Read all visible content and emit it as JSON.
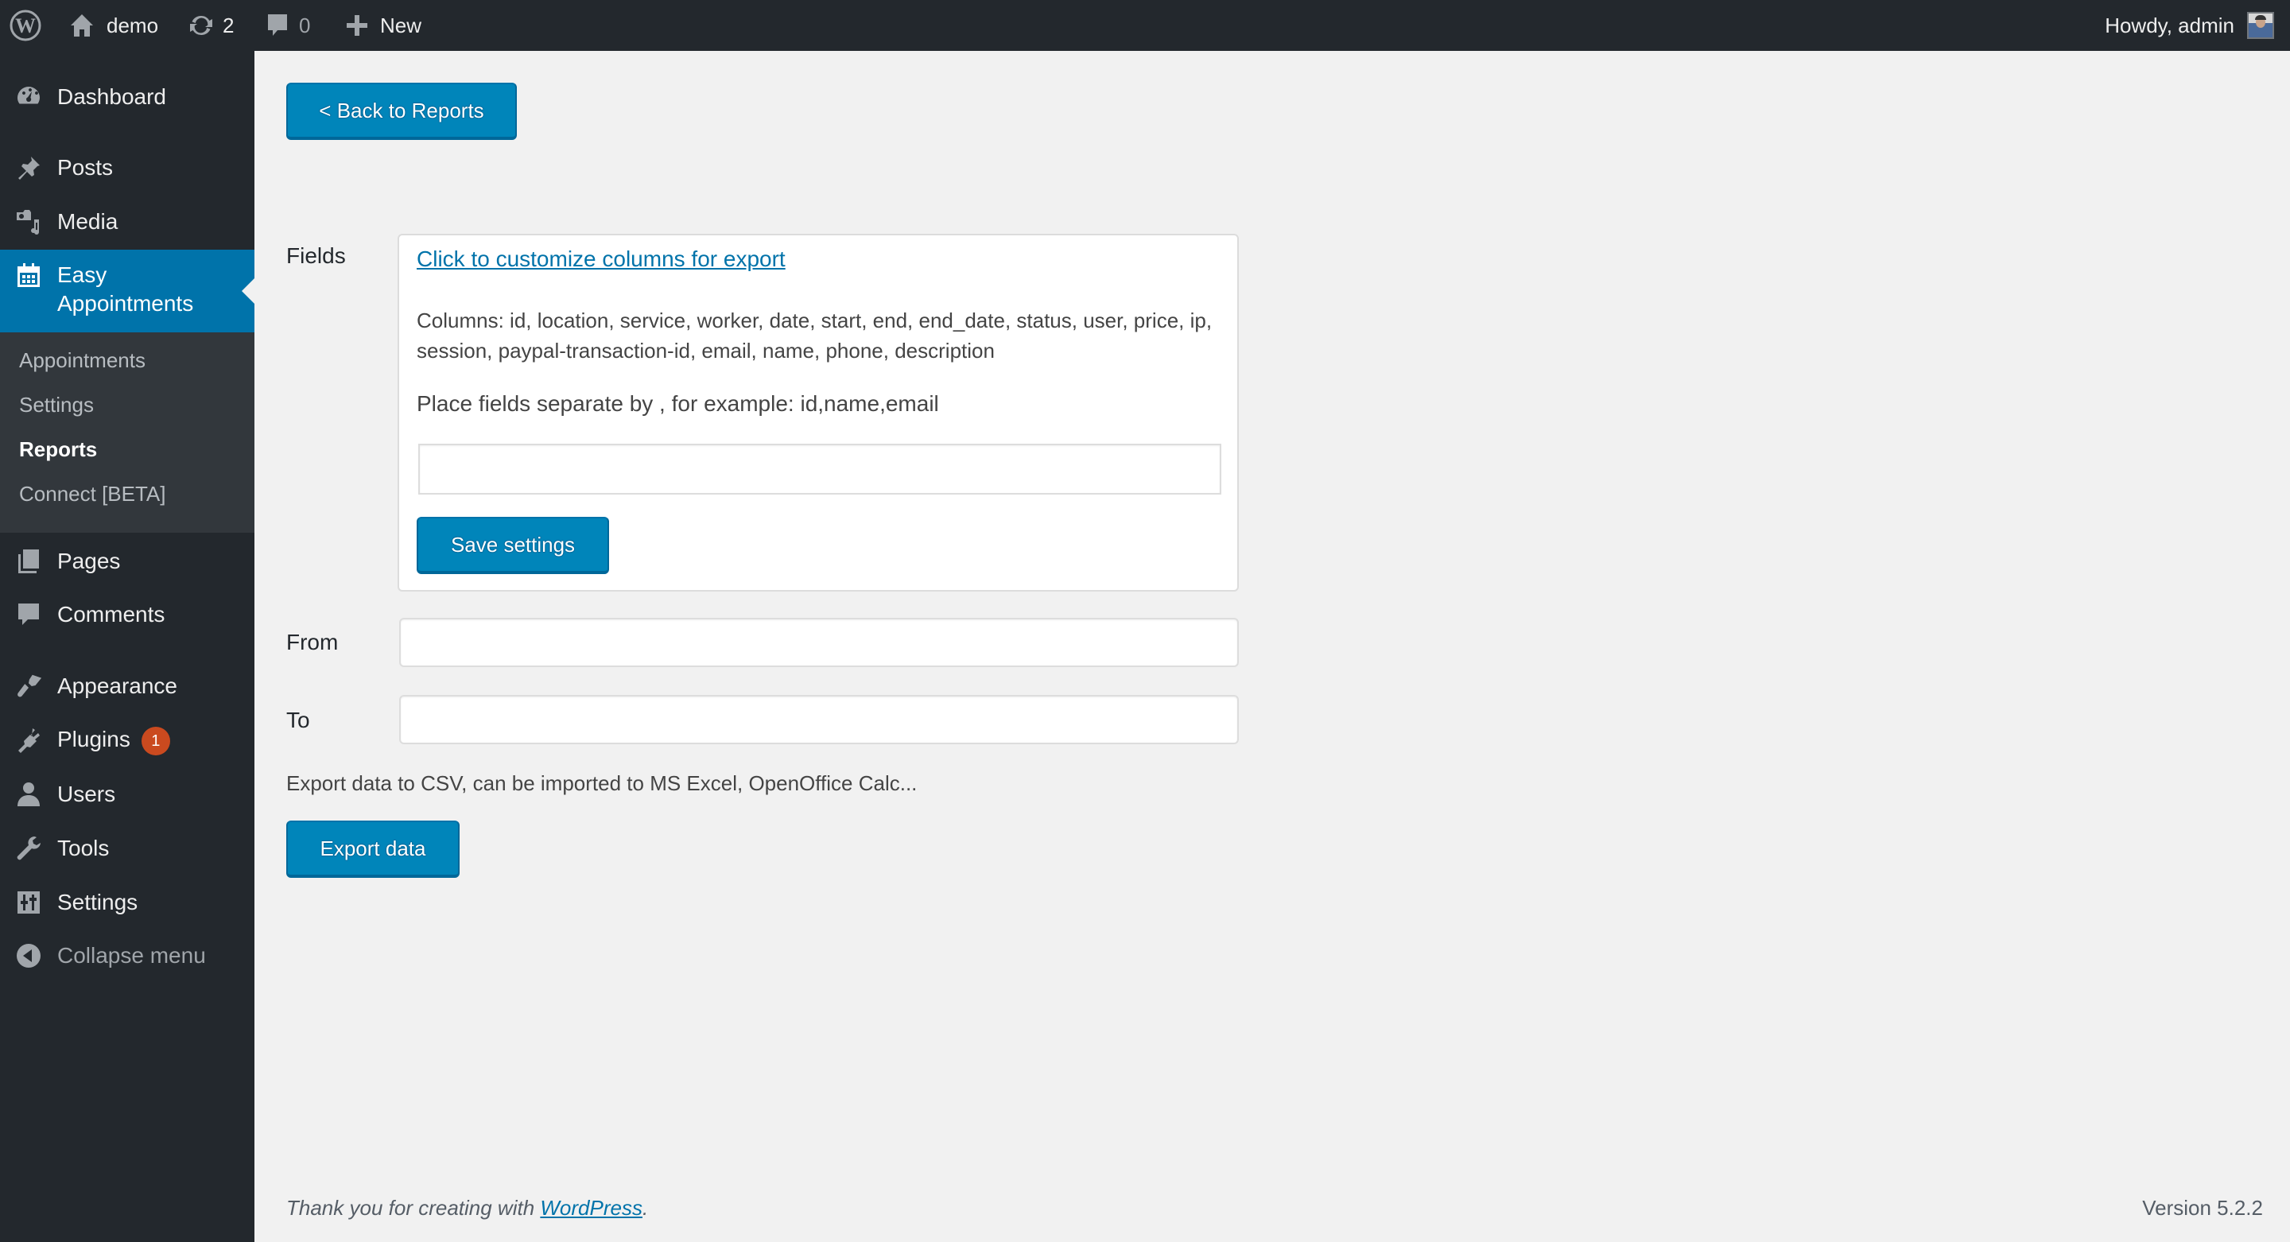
{
  "adminbar": {
    "site_name": "demo",
    "updates_count": "2",
    "comments_count": "0",
    "new_label": "New",
    "howdy": "Howdy, admin"
  },
  "sidebar": {
    "items": [
      {
        "label": "Dashboard",
        "icon": "dashboard-icon"
      },
      {
        "label": "Posts",
        "icon": "pin-icon"
      },
      {
        "label": "Media",
        "icon": "media-icon"
      },
      {
        "label": "Easy Appointments",
        "icon": "calendar-icon",
        "active": true
      },
      {
        "label": "Pages",
        "icon": "pages-icon"
      },
      {
        "label": "Comments",
        "icon": "comment-icon"
      },
      {
        "label": "Appearance",
        "icon": "paintbrush-icon"
      },
      {
        "label": "Plugins",
        "icon": "plugin-icon",
        "badge": "1"
      },
      {
        "label": "Users",
        "icon": "user-icon"
      },
      {
        "label": "Tools",
        "icon": "wrench-icon"
      },
      {
        "label": "Settings",
        "icon": "settings-icon"
      },
      {
        "label": "Collapse menu",
        "icon": "collapse-icon"
      }
    ],
    "easy_appointments_line1": "Easy",
    "easy_appointments_line2": "Appointments",
    "submenu": [
      {
        "label": "Appointments"
      },
      {
        "label": "Settings"
      },
      {
        "label": "Reports",
        "current": true
      },
      {
        "label": "Connect [BETA]"
      }
    ]
  },
  "main": {
    "back_button": "< Back to Reports",
    "fields_label": "Fields",
    "customize_link": "Click to customize columns for export",
    "columns_text": "Columns: id, location, service, worker, date, start, end, end_date, status, user, price, ip, session, paypal-transaction-id, email, name, phone, description",
    "place_text": "Place fields separate by , for example: id,name,email",
    "fields_input_value": "",
    "save_button": "Save settings",
    "from_label": "From",
    "from_value": "",
    "to_label": "To",
    "to_value": "",
    "export_description": "Export data to CSV, can be imported to MS Excel, OpenOffice Calc...",
    "export_button": "Export data"
  },
  "footer": {
    "thanks_prefix": "Thank you for creating with ",
    "wordpress_link": "WordPress",
    "thanks_suffix": ".",
    "version": "Version 5.2.2"
  },
  "colors": {
    "adminbar_bg": "#23282d",
    "accent": "#0073aa",
    "button": "#0085ba",
    "badge": "#ca4a1f",
    "page_bg": "#f1f1f1"
  }
}
